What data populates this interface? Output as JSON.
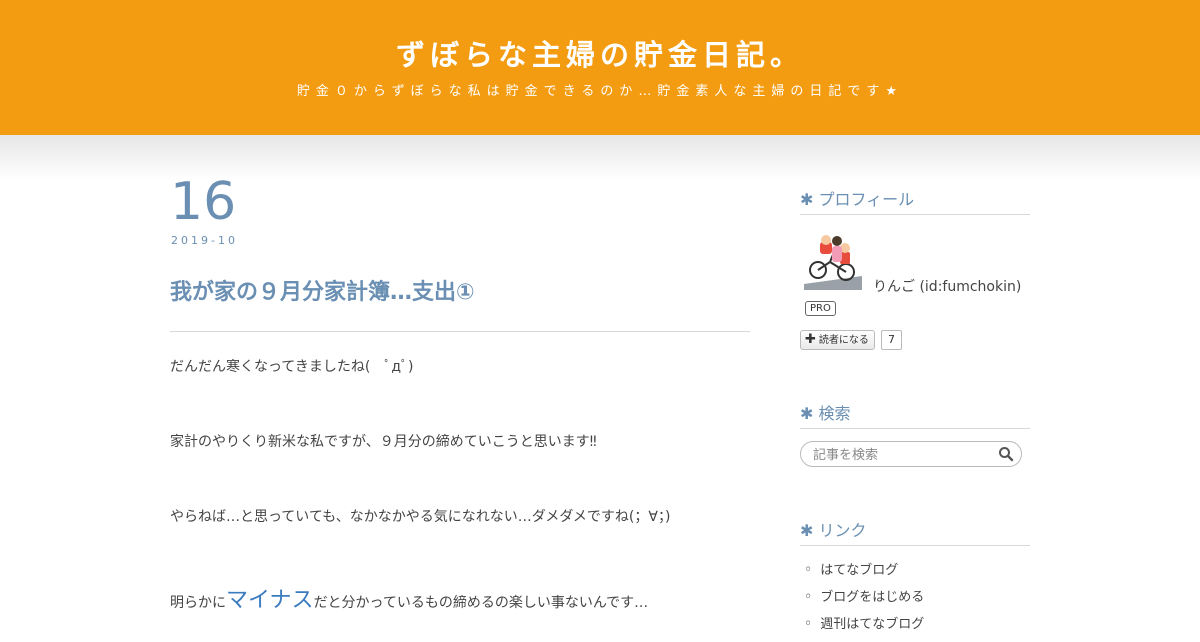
{
  "header": {
    "title": "ずぼらな主婦の貯金日記。",
    "description": "貯金０からずぼらな私は貯金できるのか…貯金素人な主婦の日記です★",
    "color": "#f39c12"
  },
  "entry": {
    "day": "16",
    "year_month": "2019-10",
    "title": "我が家の９月分家計簿…支出①",
    "paragraphs": {
      "p1": "だんだん寒くなってきましたね(　ﾟдﾟ)",
      "p2": "家計のやりくり新米な私ですが、９月分の締めていこうと思います‼",
      "p3": "やらねば…と思っていても、なかなかやる気になれない…ダメダメですね(；∀；)",
      "p4_before": "明らかに",
      "p4_emphasis": "マイナス",
      "p4_after": "だと分かっているもの締めるの楽しい事ないんです…"
    },
    "accent_color": "#6a8fb3"
  },
  "sidebar": {
    "profile": {
      "heading": "✱ プロフィール",
      "user_name": "りんご (id:fumchokin)",
      "badge": "PRO",
      "reader_button": "読者になる",
      "reader_count": "7"
    },
    "search": {
      "heading": "✱ 検索",
      "placeholder": "記事を検索",
      "icon": "search-icon"
    },
    "links": {
      "heading": "✱ リンク",
      "items": [
        "はてなブログ",
        "ブログをはじめる",
        "週刊はてなブログ"
      ]
    }
  }
}
